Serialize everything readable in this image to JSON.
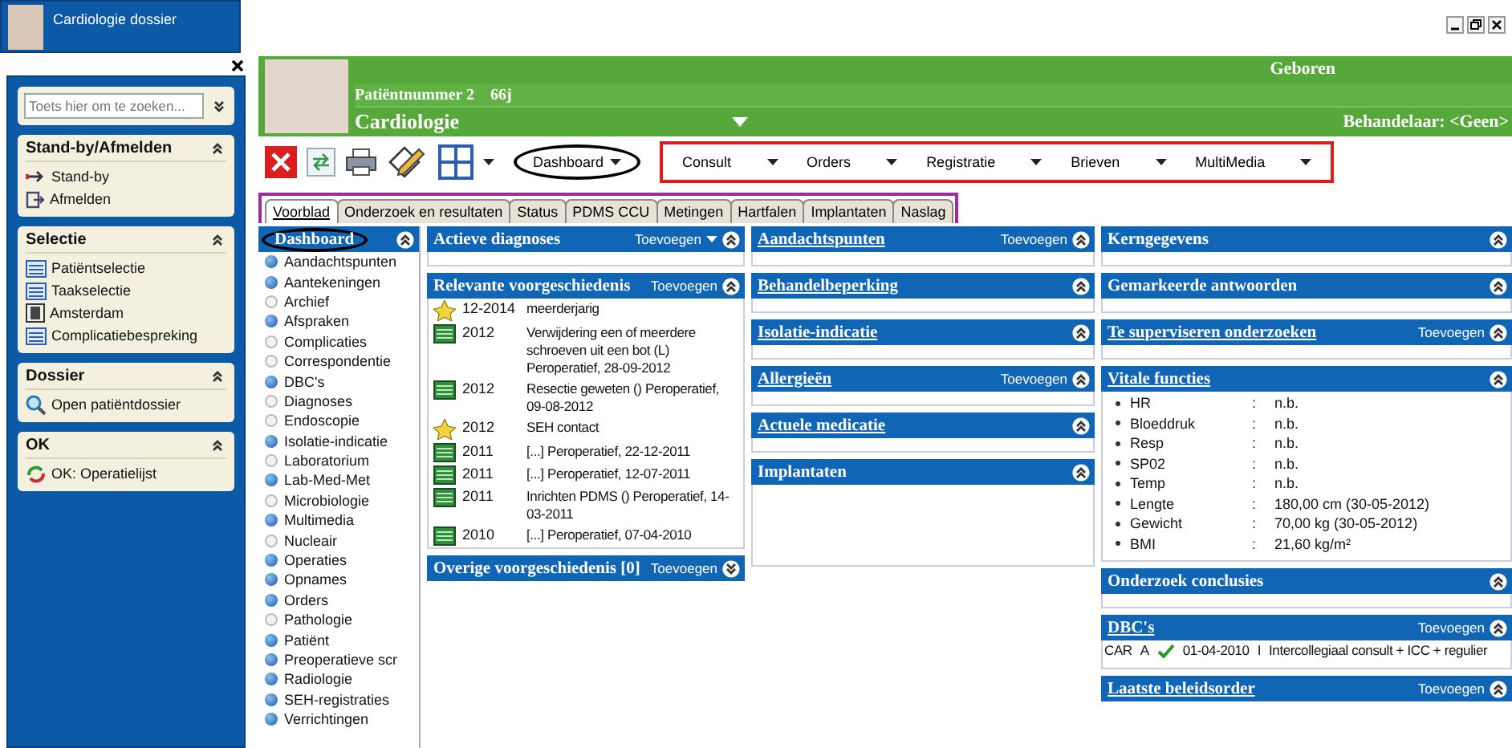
{
  "taskbar": {
    "title": "Cardiologie dossier"
  },
  "sidebar": {
    "search": {
      "placeholder": "Toets hier om te zoeken..."
    },
    "sections": [
      {
        "title": "Stand-by/Afmelden",
        "expanded": true,
        "items": [
          {
            "label": "Stand-by",
            "kind": "standby"
          },
          {
            "label": "Afmelden",
            "kind": "logout"
          }
        ]
      },
      {
        "title": "Selectie",
        "expanded": true,
        "items": [
          {
            "label": "Patiëntselectie",
            "kind": "list"
          },
          {
            "label": "Taakselectie",
            "kind": "list"
          },
          {
            "label": "Amsterdam",
            "kind": "book"
          },
          {
            "label": "Complicatiebespreking",
            "kind": "list"
          }
        ]
      },
      {
        "title": "Dossier",
        "expanded": true,
        "items": [
          {
            "label": "Open patiëntdossier",
            "kind": "search"
          }
        ]
      },
      {
        "title": "OK",
        "expanded": true,
        "items": [
          {
            "label": "OK: Operatielijst",
            "kind": "refresh"
          }
        ]
      }
    ]
  },
  "patient": {
    "number": "Patiëntnummer 2",
    "age": "66j",
    "department": "Cardiologie",
    "born_label": "Geboren",
    "practitioner": "Behandelaar: <Geen>"
  },
  "toolbar": {
    "dashboard": {
      "label": "Dashboard",
      "highlighted": true
    },
    "menus_highlighted": true,
    "menus": [
      "Consult",
      "Orders",
      "Registratie",
      "Brieven",
      "MultiMedia"
    ]
  },
  "tab_bar": {
    "highlighted": true,
    "tabs": [
      {
        "label": "Voorblad",
        "selected": true
      },
      {
        "label": "Onderzoek en resultaten",
        "selected": false
      },
      {
        "label": "Status",
        "selected": false
      },
      {
        "label": "PDMS CCU",
        "selected": false
      },
      {
        "label": "Metingen",
        "selected": false
      },
      {
        "label": "Hartfalen",
        "selected": false
      },
      {
        "label": "Implantaten",
        "selected": false
      },
      {
        "label": "Naslag",
        "selected": false
      }
    ]
  },
  "dashboard": {
    "title": "Dashboard",
    "highlighted": true,
    "expanded": true,
    "items": [
      {
        "label": "Aandachtspunten",
        "on": true
      },
      {
        "label": "Aantekeningen",
        "on": true
      },
      {
        "label": "Archief",
        "on": false
      },
      {
        "label": "Afspraken",
        "on": true
      },
      {
        "label": "Complicaties",
        "on": false
      },
      {
        "label": "Correspondentie",
        "on": false
      },
      {
        "label": "DBC's",
        "on": true
      },
      {
        "label": "Diagnoses",
        "on": false
      },
      {
        "label": "Endoscopie",
        "on": false
      },
      {
        "label": "Isolatie-indicatie",
        "on": true
      },
      {
        "label": "Laboratorium",
        "on": false
      },
      {
        "label": "Lab-Med-Met",
        "on": true
      },
      {
        "label": "Microbiologie",
        "on": false
      },
      {
        "label": "Multimedia",
        "on": true
      },
      {
        "label": "Nucleair",
        "on": false
      },
      {
        "label": "Operaties",
        "on": true
      },
      {
        "label": "Opnames",
        "on": true
      },
      {
        "label": "Orders",
        "on": true
      },
      {
        "label": "Pathologie",
        "on": false
      },
      {
        "label": "Patiënt",
        "on": true
      },
      {
        "label": "Preoperatieve scr",
        "on": true
      },
      {
        "label": "Radiologie",
        "on": true
      },
      {
        "label": "SEH-registraties",
        "on": true
      },
      {
        "label": "Verrichtingen",
        "on": true
      }
    ]
  },
  "columns": [
    {
      "panels": [
        {
          "title": "Actieve diagnoses",
          "link": false,
          "add": "Toevoegen",
          "add_menu": true,
          "expanded": true,
          "kind": "empty"
        },
        {
          "title": "Relevante voorgeschiedenis",
          "link": false,
          "add": "Toevoegen",
          "add_menu": false,
          "expanded": true,
          "kind": "history",
          "rows": [
            {
              "kind": "star",
              "date": "12-2014",
              "text": "meerderjarig"
            },
            {
              "kind": "record",
              "date": "2012",
              "text": "Verwijdering een of meerdere schroeven uit een bot (L) Peroperatief, 28-09-2012"
            },
            {
              "kind": "record",
              "date": "2012",
              "text": "Resectie geweten () Peroperatief, 09-08-2012"
            },
            {
              "kind": "star",
              "date": "2012",
              "text": "SEH contact"
            },
            {
              "kind": "record",
              "date": "2011",
              "text": "[...] Peroperatief, 22-12-2011"
            },
            {
              "kind": "record",
              "date": "2011",
              "text": "[...] Peroperatief, 12-07-2011"
            },
            {
              "kind": "record",
              "date": "2011",
              "text": "Inrichten PDMS () Peroperatief, 14-03-2011"
            },
            {
              "kind": "record",
              "date": "2010",
              "text": "[...] Peroperatief, 07-04-2010"
            }
          ]
        },
        {
          "title": "Overige voorgeschiedenis [0]",
          "link": false,
          "add": "Toevoegen",
          "add_menu": false,
          "expanded": false,
          "kind": "none"
        }
      ]
    },
    {
      "panels": [
        {
          "title": "Aandachtspunten",
          "link": true,
          "add": "Toevoegen",
          "add_menu": false,
          "expanded": true,
          "kind": "empty"
        },
        {
          "title": "Behandelbeperking",
          "link": true,
          "add_menu": false,
          "expanded": true,
          "kind": "empty"
        },
        {
          "title": "Isolatie-indicatie",
          "link": true,
          "add_menu": false,
          "expanded": true,
          "kind": "empty"
        },
        {
          "title": "Allergieën",
          "link": true,
          "add": "Toevoegen",
          "add_menu": false,
          "expanded": true,
          "kind": "empty"
        },
        {
          "title": "Actuele medicatie",
          "link": true,
          "add_menu": false,
          "expanded": true,
          "kind": "empty"
        },
        {
          "title": "Implantaten",
          "link": false,
          "add_menu": false,
          "expanded": true,
          "kind": "tall"
        }
      ]
    },
    {
      "panels": [
        {
          "title": "Kerngegevens",
          "link": false,
          "add_menu": false,
          "expanded": true,
          "kind": "empty"
        },
        {
          "title": "Gemarkeerde antwoorden",
          "link": false,
          "add_menu": false,
          "expanded": true,
          "kind": "empty"
        },
        {
          "title": "Te superviseren onderzoeken",
          "link": true,
          "add": "Toevoegen",
          "add_menu": false,
          "expanded": true,
          "kind": "empty"
        },
        {
          "title": "Vitale functies",
          "link": true,
          "add_menu": false,
          "expanded": true,
          "kind": "vitals",
          "rows": [
            {
              "label": "HR",
              "sep": ":",
              "value": "n.b."
            },
            {
              "label": "Bloeddruk",
              "sep": ":",
              "value": "n.b."
            },
            {
              "label": "Resp",
              "sep": ":",
              "value": "n.b."
            },
            {
              "label": "SP02",
              "sep": ":",
              "value": "n.b."
            },
            {
              "label": "Temp",
              "sep": ":",
              "value": "n.b."
            },
            {
              "label": "Lengte",
              "sep": ":",
              "value": "180,00 cm (30-05-2012)"
            },
            {
              "label": "Gewicht",
              "sep": ":",
              "value": "70,00 kg (30-05-2012)"
            },
            {
              "label": "BMI",
              "sep": ":",
              "value": "21,60 kg/m²"
            }
          ]
        },
        {
          "title": "Onderzoek conclusies",
          "link": false,
          "add_menu": false,
          "expanded": true,
          "kind": "empty"
        },
        {
          "title": "DBC's",
          "link": true,
          "add": "Toevoegen",
          "add_menu": false,
          "expanded": true,
          "kind": "dbc",
          "row": {
            "code": "CAR",
            "grade": "A",
            "checked": true,
            "date": "01-04-2010",
            "type": "I",
            "description": "Intercollegiaal consult + ICC + regulier"
          }
        },
        {
          "title": "Laatste beleidsorder",
          "link": true,
          "add": "Toevoegen",
          "add_menu": false,
          "expanded": true,
          "kind": "none"
        }
      ]
    }
  ]
}
